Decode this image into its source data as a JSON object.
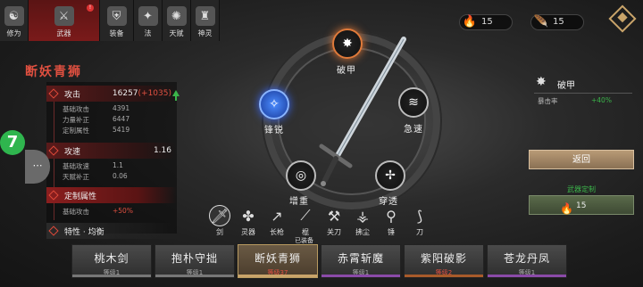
{
  "tabs": [
    {
      "label": "修为",
      "icon": "cultivation-icon",
      "glyph": "☯"
    },
    {
      "label": "武器",
      "icon": "sword-icon",
      "glyph": "⚔",
      "badge": "!"
    },
    {
      "label": "装备",
      "icon": "armor-icon",
      "glyph": "⛨"
    },
    {
      "label": "法",
      "icon": "scroll-icon",
      "glyph": "✦"
    },
    {
      "label": "天赋",
      "icon": "talent-icon",
      "glyph": "✺"
    },
    {
      "label": "神灵",
      "icon": "deity-icon",
      "glyph": "♜"
    }
  ],
  "currency": [
    {
      "icon": "torch-icon",
      "glyph": "🔥",
      "value": "15"
    },
    {
      "icon": "feather-icon",
      "glyph": "🪶",
      "value": "15"
    }
  ],
  "weapon_name": "断妖青狮",
  "stats": {
    "attack": {
      "label": "攻击",
      "value": "16257",
      "bonus": "(+1035)"
    },
    "attack_rows": [
      {
        "label": "基础攻击",
        "value": "4391"
      },
      {
        "label": "力量补正",
        "value": "6447"
      },
      {
        "label": "定制属性",
        "value": "5419"
      }
    ],
    "speed": {
      "label": "攻速",
      "value": "1.16"
    },
    "speed_rows": [
      {
        "label": "基础攻速",
        "value": "1.1"
      },
      {
        "label": "天赋补正",
        "value": "0.06"
      }
    ],
    "custom": {
      "label": "定制属性"
    },
    "custom_rows": [
      {
        "label": "基础攻击",
        "value": "+50%"
      }
    ],
    "features": {
      "label": "特性 · 均衡"
    }
  },
  "side": {
    "bubble": "7",
    "pill": "⋯"
  },
  "compass": {
    "nodes": [
      {
        "label": "破甲",
        "glyph": "✸",
        "state": "selected"
      },
      {
        "label": "急速",
        "glyph": "≋",
        "state": "normal"
      },
      {
        "label": "穿透",
        "glyph": "✢",
        "state": "normal"
      },
      {
        "label": "增重",
        "glyph": "◎",
        "state": "normal"
      },
      {
        "label": "锋锐",
        "glyph": "✧",
        "state": "blue"
      }
    ]
  },
  "right": {
    "title": "破甲",
    "stat_label": "暴击率",
    "stat_value": "+40%",
    "back_label": "返回",
    "custom_label": "武器定制",
    "custom_value": "15"
  },
  "weapon_types": [
    {
      "label": "剑",
      "glyph": "🗡",
      "active": true
    },
    {
      "label": "灵器",
      "glyph": "✤"
    },
    {
      "label": "长枪",
      "glyph": "↗"
    },
    {
      "label": "棍",
      "glyph": "⟋"
    },
    {
      "label": "关刀",
      "glyph": "⚒"
    },
    {
      "label": "拂尘",
      "glyph": "⚶"
    },
    {
      "label": "锤",
      "glyph": "⚲"
    },
    {
      "label": "刀",
      "glyph": "⟆"
    }
  ],
  "cards": [
    {
      "name": "桃木剑",
      "level": "等级1",
      "strip": "#777"
    },
    {
      "name": "抱朴守拙",
      "level": "等级1",
      "strip": "#777"
    },
    {
      "name": "断妖青狮",
      "level": "等级37",
      "strip": "#c9a46a",
      "equipped": true,
      "tag": "已装备"
    },
    {
      "name": "赤霄斩魔",
      "level": "等级1",
      "strip": "#8a4aa8"
    },
    {
      "name": "紫阳破影",
      "level": "等级2",
      "strip": "#a85a2a"
    },
    {
      "name": "苍龙丹凤",
      "level": "等级1",
      "strip": "#8a4aa8"
    }
  ]
}
